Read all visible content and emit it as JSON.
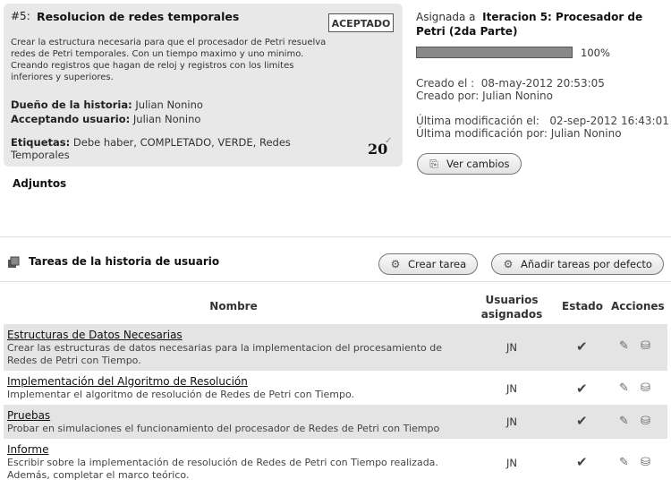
{
  "story": {
    "number": "#5:",
    "title": "Resolucion de redes temporales",
    "status_badge": "ACEPTADO",
    "description": "Crear la estructura necesaria para que el procesador de Petri resuelva redes de Petri temporales. Con un tiempo maximo y uno minimo. Creando registros que hagan de reloj y registros con los limites inferiores y superiores.",
    "owner_label": "Dueño de la historia",
    "owner": "Julian Nonino",
    "acceptor_label": "Acceptando usuario",
    "acceptor": "Julian Nonino",
    "tags_label": "Etiquetas",
    "tags": "Debe haber, COMPLETADO, VERDE, Redes Temporales",
    "points": "20",
    "attachments_label": "Adjuntos"
  },
  "details": {
    "assigned_prefix": "Asignada a",
    "iteration": "Iteracion 5: Procesador de Petri (2da Parte)",
    "progress_percent": 100,
    "progress_label": "100%",
    "created_on_label": "Creado el :",
    "created_on": "08-may-2012 20:53:05",
    "created_by_label": "Creado por:",
    "created_by": "Julian Nonino",
    "modified_on_label": "Última modificación el:",
    "modified_on": "02-sep-2012 16:43:01",
    "modified_by_label": "Última modificación por:",
    "modified_by": "Julian Nonino",
    "view_changes_label": "Ver cambios"
  },
  "tasks_section": {
    "title": "Tareas de la historia de usuario",
    "create_task_label": "Crear tarea",
    "add_default_tasks_label": "Añadir tareas por defecto",
    "columns": {
      "name": "Nombre",
      "assigned_users": "Usuarios asignados",
      "status": "Estado",
      "actions": "Acciones"
    },
    "rows": [
      {
        "name": "Estructuras de Datos Necesarias",
        "description": "Crear las estructuras de datos necesarias para la implementacion del procesamiento de Redes de Petri con Tiempo.",
        "assigned": "JN"
      },
      {
        "name": "Implementación del Algoritmo de Resolución",
        "description": "Implementar el algoritmo de resolución de Redes de Petri con Tiempo.",
        "assigned": "JN"
      },
      {
        "name": "Pruebas",
        "description": "Probar en simulaciones el funcionamiento del procesador de Redes de Petri con Tiempo",
        "assigned": "JN"
      },
      {
        "name": "Informe",
        "description": "Escribir sobre la implementación de resolución de Redes de Petri con Tiempo realizada. Además, completar el marco teórico.",
        "assigned": "JN"
      }
    ]
  }
}
